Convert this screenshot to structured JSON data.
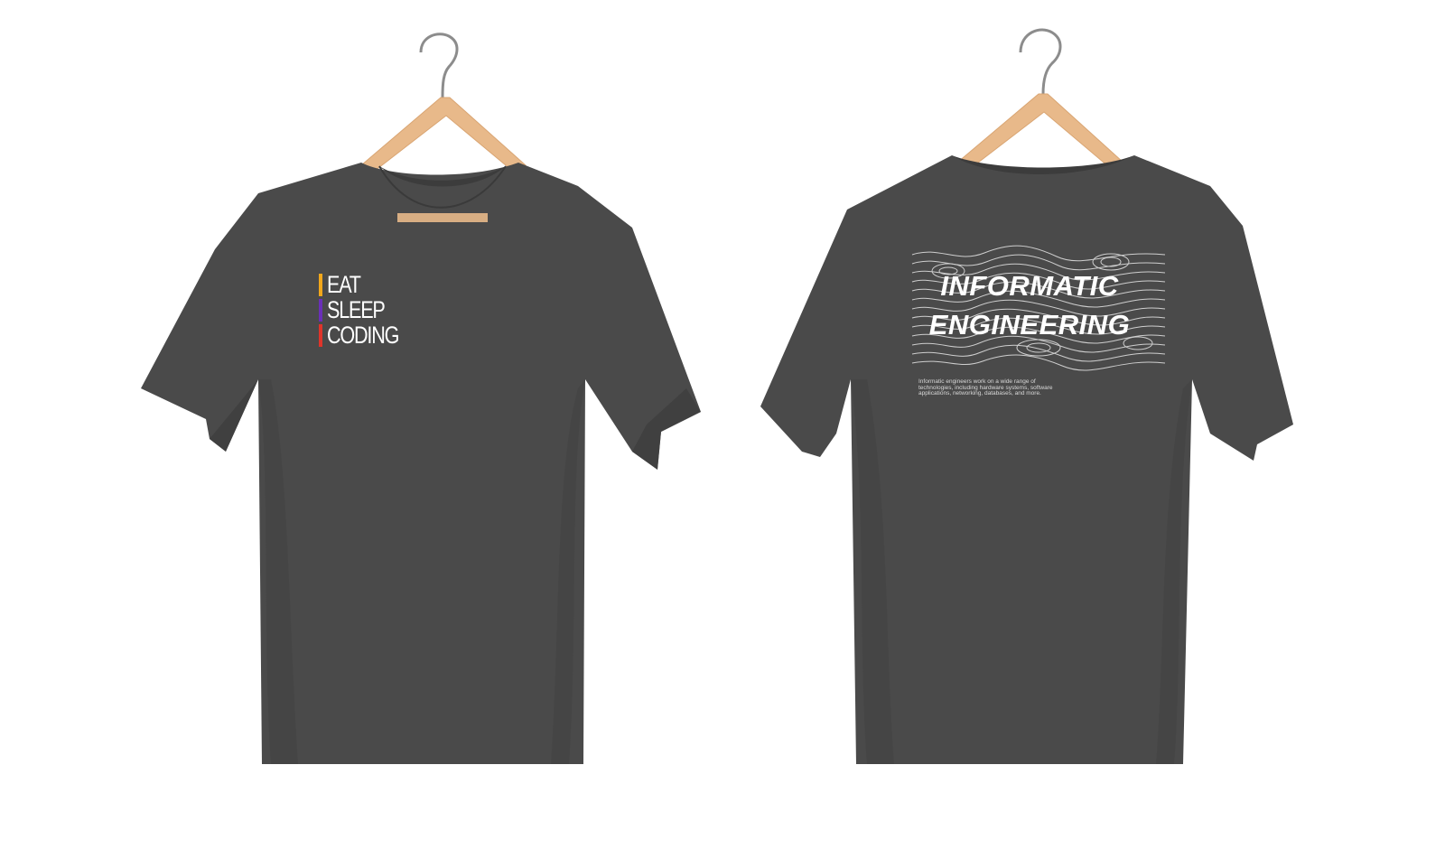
{
  "front": {
    "print_lines": [
      {
        "text": "EAT",
        "bar_color": "#f2a71b"
      },
      {
        "text": "SLEEP",
        "bar_color": "#6a2fb8"
      },
      {
        "text": "CODING",
        "bar_color": "#e0342a"
      }
    ]
  },
  "back": {
    "title_line1": "INFORMATIC",
    "title_line2": "ENGINEERING",
    "small_text": "Informatic engineers work on a wide range of technologies, including hardware systems, software applications, networking, databases, and more."
  },
  "colors": {
    "shirt": "#4a4a4a",
    "shirt_shadow": "#3c3c3c",
    "hanger_wood": "#e8b98a",
    "hanger_hook": "#8c8c8c",
    "background": "#ffffff"
  }
}
